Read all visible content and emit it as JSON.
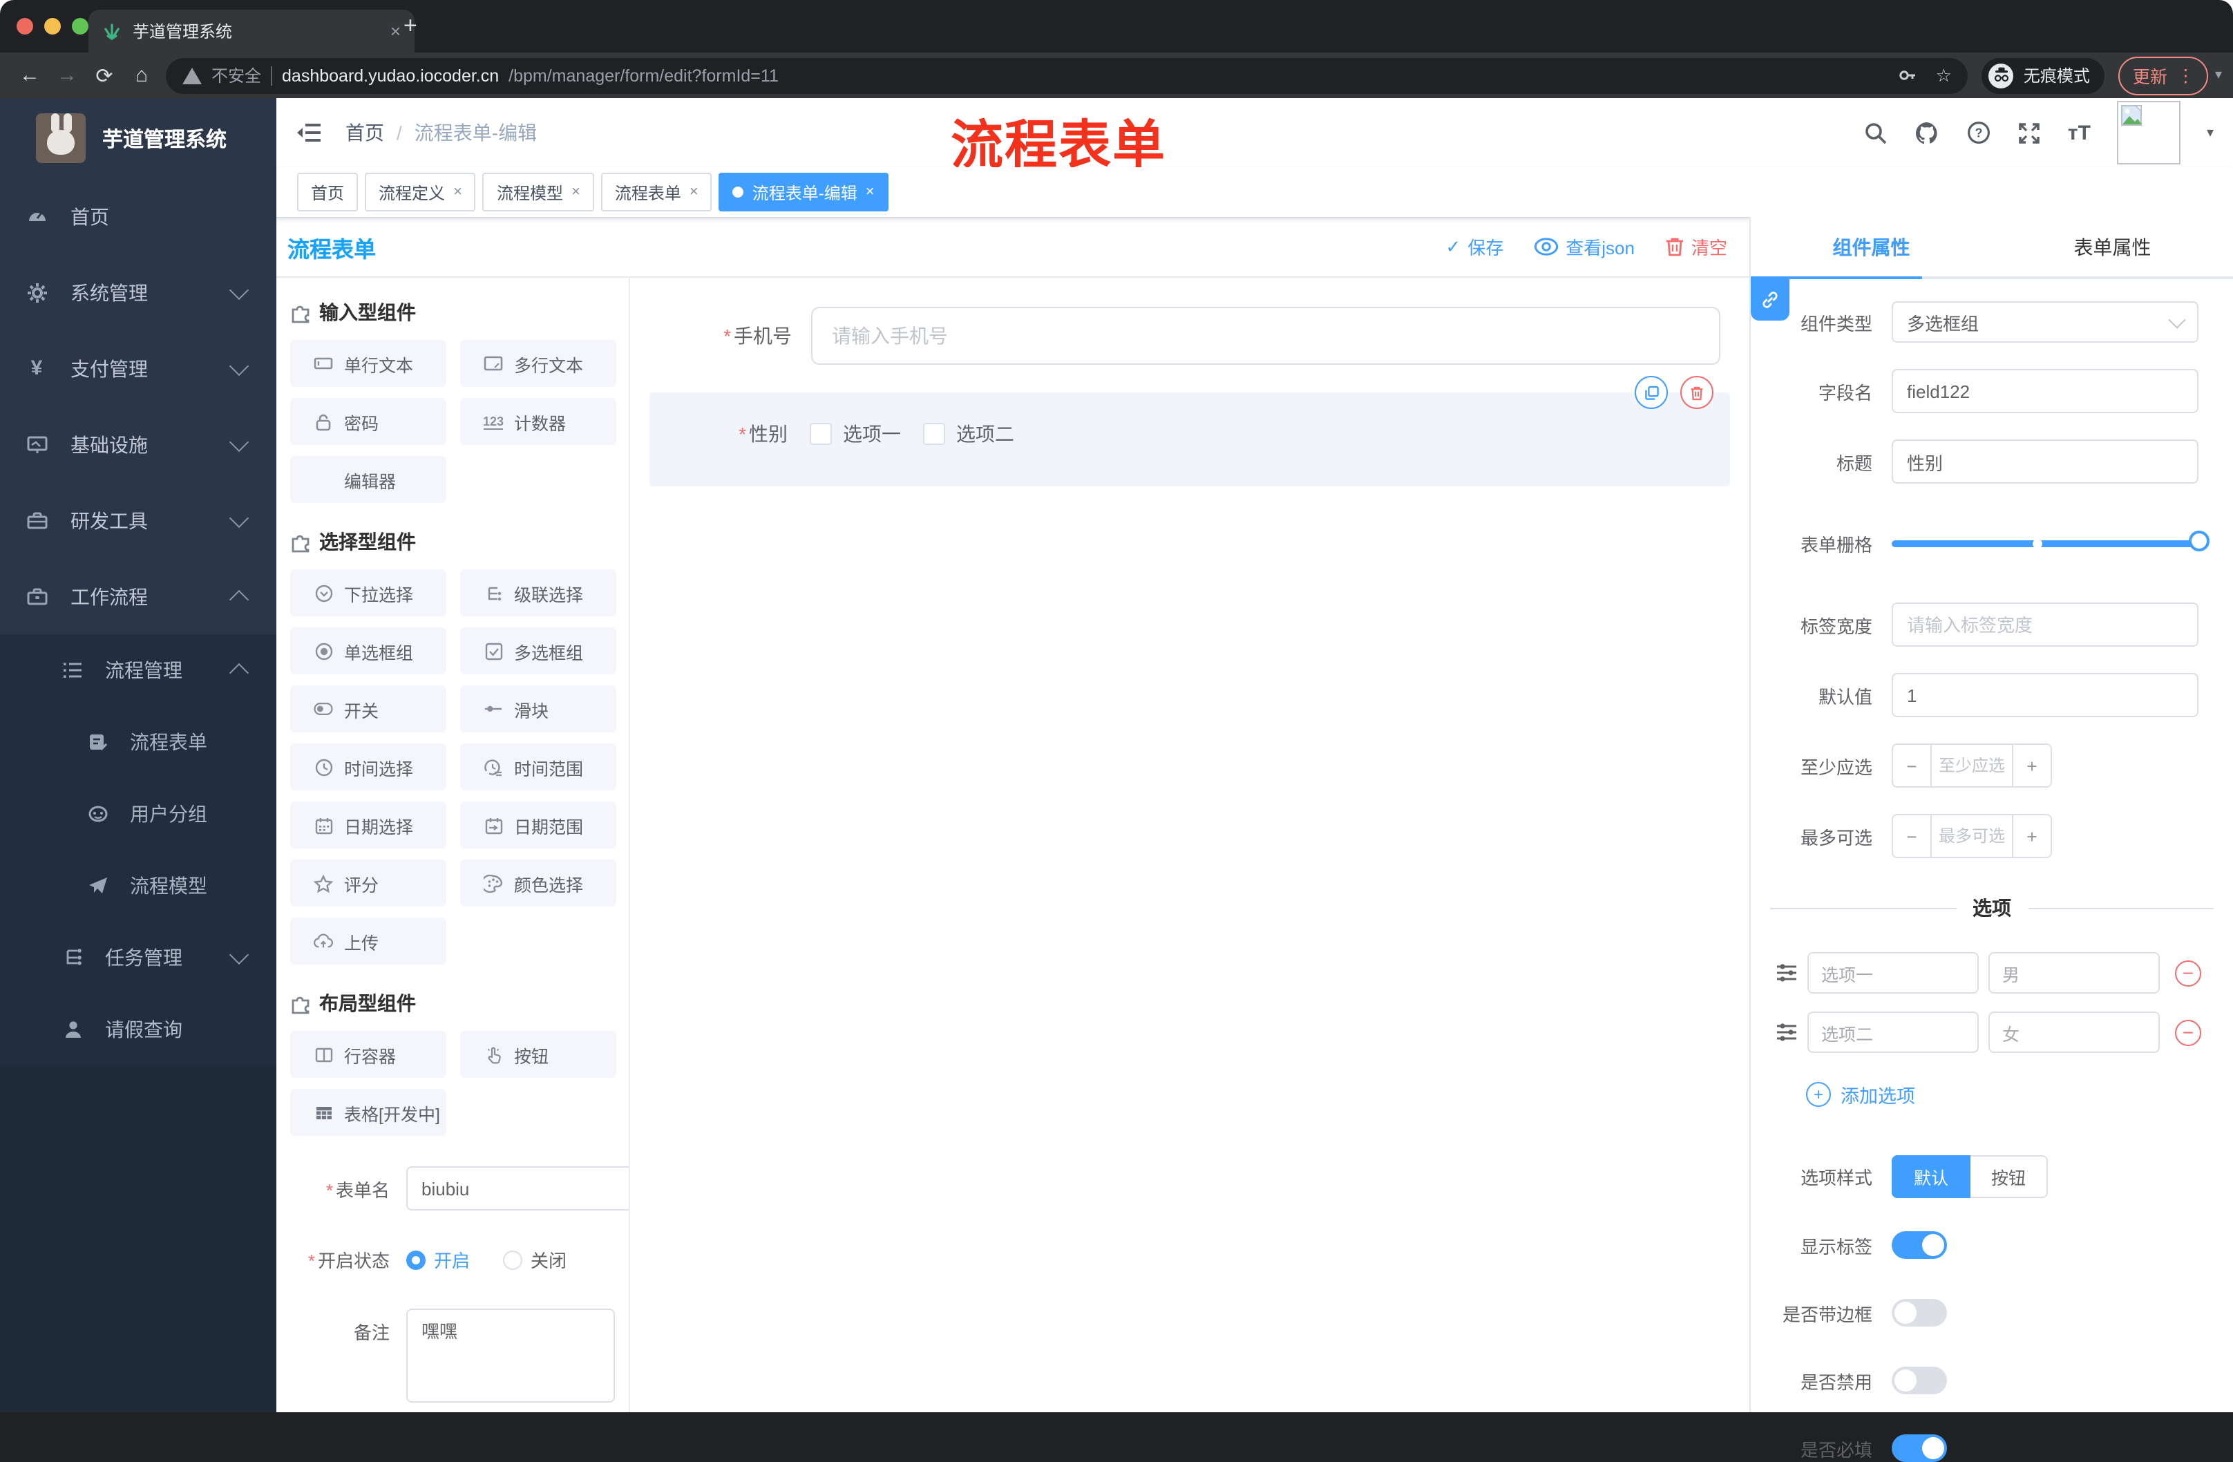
{
  "glyphs": {
    "close": "×",
    "plus": "+",
    "dots": "⋮",
    "caret": "▾",
    "check": "✓",
    "minus": "−",
    "back": "←",
    "forward": "→",
    "reload": "⟳",
    "home": "⌂",
    "star": "☆",
    "font_size": "тT",
    "add_plus": "+"
  },
  "browser": {
    "tab_title": "芋道管理系统",
    "security_label": "不安全",
    "url_host": "dashboard.yudao.iocoder.cn",
    "url_path": "/bpm/manager/form/edit?formId=11",
    "incognito_label": "无痕模式",
    "update_label": "更新"
  },
  "sidebar": {
    "logo_title": "芋道管理系统",
    "items": [
      {
        "label": "首页"
      },
      {
        "label": "系统管理"
      },
      {
        "label": "支付管理"
      },
      {
        "label": "基础设施"
      },
      {
        "label": "研发工具"
      },
      {
        "label": "工作流程"
      }
    ],
    "submenu": [
      {
        "label": "流程管理"
      },
      {
        "label": "流程表单"
      },
      {
        "label": "用户分组"
      },
      {
        "label": "流程模型"
      },
      {
        "label": "任务管理"
      },
      {
        "label": "请假查询"
      }
    ]
  },
  "header": {
    "breadcrumb_home": "首页",
    "breadcrumb_sep": "/",
    "breadcrumb_current": "流程表单-编辑",
    "annotation": "流程表单"
  },
  "tags": [
    {
      "label": "首页"
    },
    {
      "label": "流程定义"
    },
    {
      "label": "流程模型"
    },
    {
      "label": "流程表单"
    },
    {
      "label": "流程表单-编辑"
    }
  ],
  "designer": {
    "title": "流程表单",
    "save": "保存",
    "view_json": "查看json",
    "clear": "清空",
    "sections": [
      {
        "title": "输入型组件",
        "items": [
          "单行文本",
          "多行文本",
          "密码",
          "计数器",
          "编辑器"
        ]
      },
      {
        "title": "选择型组件",
        "items": [
          "下拉选择",
          "级联选择",
          "单选框组",
          "多选框组",
          "开关",
          "滑块",
          "时间选择",
          "时间范围",
          "日期选择",
          "日期范围",
          "评分",
          "颜色选择",
          "上传"
        ]
      },
      {
        "title": "布局型组件",
        "items": [
          "行容器",
          "按钮",
          "表格[开发中]"
        ]
      }
    ],
    "form": {
      "name_label": "表单名",
      "name_value": "biubiu",
      "status_label": "开启状态",
      "status_on": "开启",
      "status_off": "关闭",
      "remark_label": "备注",
      "remark_value": "嘿嘿"
    }
  },
  "canvas": {
    "phone_label": "手机号",
    "phone_placeholder": "请输入手机号",
    "gender_label": "性别",
    "option1": "选项一",
    "option2": "选项二"
  },
  "panel": {
    "tab_component": "组件属性",
    "tab_form": "表单属性",
    "type_label": "组件类型",
    "type_value": "多选框组",
    "field_label": "字段名",
    "field_value": "field122",
    "title_label": "标题",
    "title_value": "性别",
    "grid_label": "表单栅格",
    "labelwidth_label": "标签宽度",
    "labelwidth_placeholder": "请输入标签宽度",
    "default_label": "默认值",
    "default_value": "1",
    "min_label": "至少应选",
    "min_placeholder": "至少应选",
    "max_label": "最多可选",
    "max_placeholder": "最多可选",
    "options_title": "选项",
    "options": [
      {
        "label": "选项一",
        "value": "男"
      },
      {
        "label": "选项二",
        "value": "女"
      }
    ],
    "add_option": "添加选项",
    "style_label": "选项样式",
    "style_default": "默认",
    "style_button": "按钮",
    "toggles": [
      {
        "label": "显示标签"
      },
      {
        "label": "是否带边框"
      },
      {
        "label": "是否禁用"
      },
      {
        "label": "是否必填"
      }
    ]
  }
}
